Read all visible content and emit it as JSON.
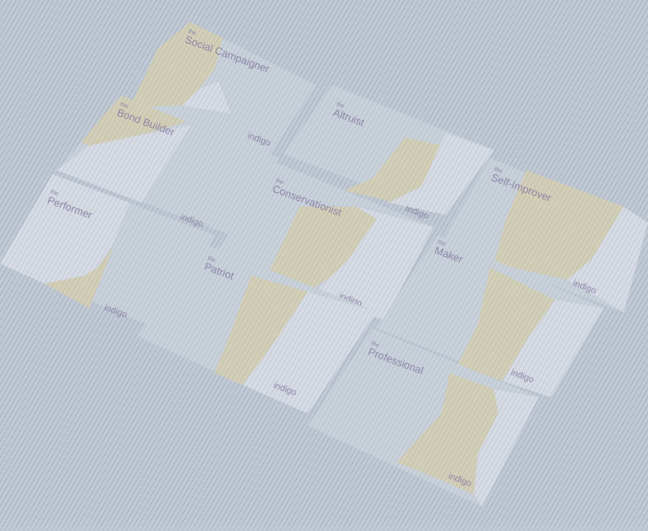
{
  "colors": {
    "background": "#c0c9d4",
    "card_base": "#c9d1da",
    "card_light": "#d6dbe4",
    "card_accent": "#d3cfb6",
    "text": "#8f86a8"
  },
  "cards": [
    {
      "prefix": "the",
      "title": "Social Campaigner",
      "brand": "indigo"
    },
    {
      "prefix": "the",
      "title": "Altruist",
      "brand": ""
    },
    {
      "prefix": "the",
      "title": "Bond Builder",
      "brand": "indigo"
    },
    {
      "prefix": "the",
      "title": "Performer",
      "brand": "indigo"
    },
    {
      "prefix": "the",
      "title": "Conservationist",
      "brand": "indigo"
    },
    {
      "prefix": "the",
      "title": "Self-Improver",
      "brand": "indigo"
    },
    {
      "prefix": "the",
      "title": "Patriot",
      "brand": "indigo"
    },
    {
      "prefix": "the",
      "title": "Maker",
      "brand": "indigo"
    },
    {
      "prefix": "the",
      "title": "Professional",
      "brand": "indigo"
    }
  ],
  "extra_brands": [
    "indigo",
    "indigo"
  ]
}
